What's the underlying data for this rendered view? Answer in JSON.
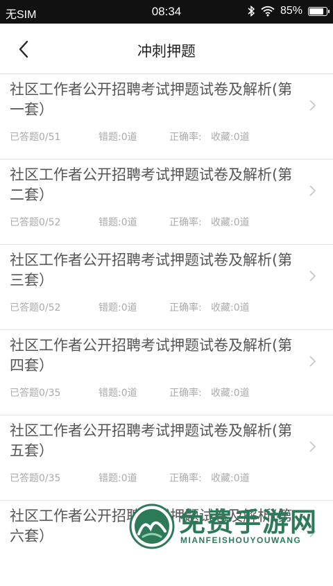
{
  "status_bar": {
    "carrier": "无SIM",
    "time": "08:34",
    "battery_percent": "85%",
    "battery_level": 0.85,
    "icons": [
      "bluetooth-icon",
      "wifi-icon",
      "battery-icon"
    ]
  },
  "header": {
    "title": "冲刺押题",
    "back_icon": "chevron-left-icon"
  },
  "items": [
    {
      "title": "社区工作者公开招聘考试押题试卷及解析(第一套）",
      "answered": "已答题0/51",
      "wrong": "错题:0道",
      "accuracy": "正确率:",
      "favorites": "收藏:0道"
    },
    {
      "title": "社区工作者公开招聘考试押题试卷及解析(第二套）",
      "answered": "已答题0/52",
      "wrong": "错题:0道",
      "accuracy": "正确率:",
      "favorites": "收藏:0道"
    },
    {
      "title": "社区工作者公开招聘考试押题试卷及解析(第三套）",
      "answered": "已答题0/52",
      "wrong": "错题:0道",
      "accuracy": "正确率:",
      "favorites": "收藏:0道"
    },
    {
      "title": "社区工作者公开招聘考试押题试卷及解析(第四套）",
      "answered": "已答题0/35",
      "wrong": "错题:0道",
      "accuracy": "正确率:",
      "favorites": "收藏:0道"
    },
    {
      "title": "社区工作者公开招聘考试押题试卷及解析(第五套）",
      "answered": "已答题0/35",
      "wrong": "错题:0道",
      "accuracy": "正确率:",
      "favorites": "收藏:0道"
    },
    {
      "title": "社区工作者公开招聘考试押题试卷及解析(第六套）",
      "answered": "",
      "wrong": "",
      "accuracy": "",
      "favorites": ""
    }
  ],
  "watermark": {
    "text": "免费手游网",
    "subtext": "MIANFEISHOUYOUWANG",
    "color": "#2d7a58"
  }
}
